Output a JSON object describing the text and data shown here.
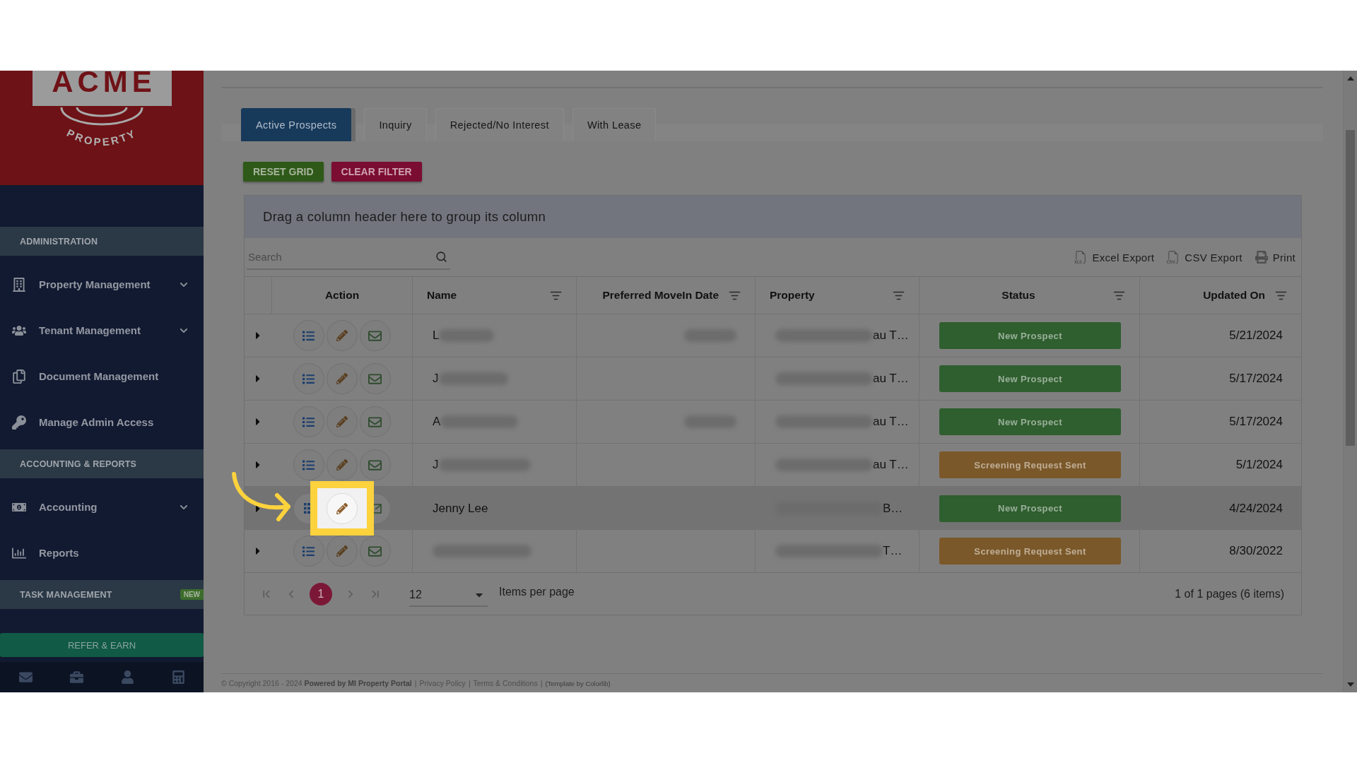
{
  "sidebar": {
    "logo": {
      "wordmark": "ACME",
      "tagline": "PROPERTY"
    },
    "sections": [
      {
        "title": "ADMINISTRATION",
        "items": [
          {
            "label": "Property Management",
            "expandable": true
          },
          {
            "label": "Tenant Management",
            "expandable": true
          },
          {
            "label": "Document Management",
            "expandable": false
          },
          {
            "label": "Manage Admin Access",
            "expandable": false
          }
        ]
      },
      {
        "title": "ACCOUNTING & REPORTS",
        "items": [
          {
            "label": "Accounting",
            "expandable": true
          },
          {
            "label": "Reports",
            "expandable": false
          }
        ]
      },
      {
        "title": "TASK MANAGEMENT",
        "badge": "NEW"
      }
    ],
    "refer_button": "REFER & EARN"
  },
  "tabs": [
    {
      "label": "Active Prospects",
      "selected": true
    },
    {
      "label": "Inquiry",
      "selected": false
    },
    {
      "label": "Rejected/No Interest",
      "selected": false
    },
    {
      "label": "With Lease",
      "selected": false
    }
  ],
  "buttons": [
    {
      "label": "RESET GRID",
      "kind": "reset"
    },
    {
      "label": "CLEAR FILTER",
      "kind": "clear"
    }
  ],
  "grid": {
    "group_hint": "Drag a column header here to group its column",
    "search": {
      "placeholder": "Search"
    },
    "tools": [
      {
        "label": "Excel Export",
        "kind": "excel"
      },
      {
        "label": "CSV Export",
        "kind": "csv"
      },
      {
        "label": "Print",
        "kind": "print"
      }
    ],
    "columns": [
      {
        "label": "Action",
        "filter": false
      },
      {
        "label": "Name",
        "filter": true
      },
      {
        "label": "Preferred MoveIn Date",
        "filter": true
      },
      {
        "label": "Property",
        "filter": true
      },
      {
        "label": "Status",
        "filter": true
      },
      {
        "label": "Updated On",
        "filter": true
      }
    ],
    "rows": [
      {
        "name": "L",
        "name_blurred": true,
        "move_in_blurred": true,
        "property": "au T…",
        "property_blurred": true,
        "status": {
          "label": "New Prospect",
          "color": "#2f5e2f"
        },
        "updated_on": "5/21/2024",
        "hovered": false,
        "edit_spotlit": false
      },
      {
        "name": "J",
        "name_blurred": true,
        "move_in_blurred": false,
        "property": "au T…",
        "property_blurred": true,
        "status": {
          "label": "New Prospect",
          "color": "#2f5e2f"
        },
        "updated_on": "5/17/2024",
        "hovered": false,
        "edit_spotlit": false
      },
      {
        "name": "A",
        "name_blurred": true,
        "move_in_blurred": true,
        "property": "au T…",
        "property_blurred": true,
        "status": {
          "label": "New Prospect",
          "color": "#2f5e2f"
        },
        "updated_on": "5/17/2024",
        "hovered": false,
        "edit_spotlit": false
      },
      {
        "name": "J",
        "name_blurred": true,
        "move_in_blurred": false,
        "property": "au T…",
        "property_blurred": true,
        "status": {
          "label": "Screening Request Sent",
          "color": "#7b5829"
        },
        "updated_on": "5/1/2024",
        "hovered": false,
        "edit_spotlit": false
      },
      {
        "name": "Jenny Lee",
        "name_blurred": false,
        "move_in_blurred": false,
        "property": "B…",
        "property_blurred": true,
        "status": {
          "label": "New Prospect",
          "color": "#2f5e2f"
        },
        "updated_on": "4/24/2024",
        "hovered": true,
        "edit_spotlit": true
      },
      {
        "name_blurred": true,
        "move_in_blurred": false,
        "property": "T…",
        "property_blurred": true,
        "status": {
          "label": "Screening Request Sent",
          "color": "#7b5829"
        },
        "updated_on": "8/30/2022",
        "hovered": false,
        "edit_spotlit": false
      }
    ],
    "pager": {
      "pages": [
        {
          "label": "1",
          "selected": true
        }
      ],
      "page_size": "12",
      "page_size_label": "Items per page",
      "info": "1 of 1 pages (6 items)"
    }
  },
  "footer": [
    {
      "kind": "text",
      "text": "© Copyright 2016 - 2024 **Powered by MI Property Portal**"
    },
    {
      "kind": "separator",
      "text": "|"
    },
    {
      "kind": "link",
      "text": "Privacy Policy"
    },
    {
      "kind": "separator",
      "text": "|"
    },
    {
      "kind": "link",
      "text": "Terms & Conditions"
    },
    {
      "kind": "separator",
      "text": "|"
    },
    {
      "kind": "credit",
      "text": "(Template by Colorlib)"
    }
  ]
}
